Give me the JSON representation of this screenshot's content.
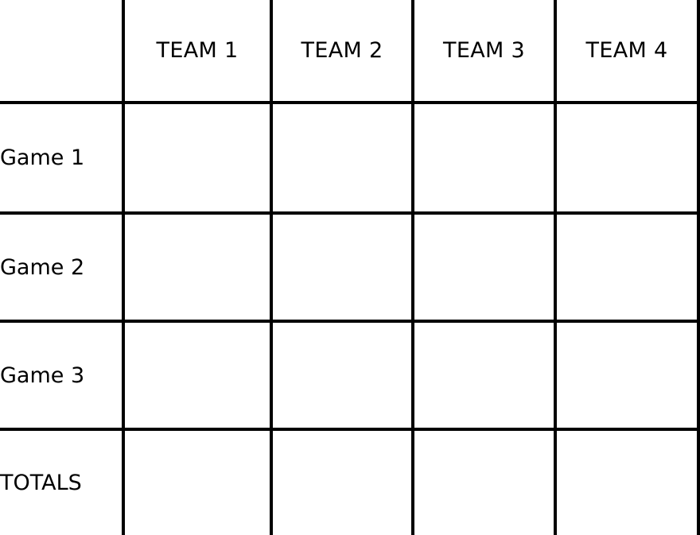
{
  "table": {
    "name": "team-game-score-grid",
    "corner_label": "",
    "column_headers": [
      {
        "id": "team-1",
        "label": "TEAM 1"
      },
      {
        "id": "team-2",
        "label": "TEAM 2"
      },
      {
        "id": "team-3",
        "label": "TEAM 3"
      },
      {
        "id": "team-4",
        "label": "TEAM 4"
      }
    ],
    "rows": [
      {
        "id": "game-1",
        "label": "Game 1",
        "cells": [
          "",
          "",
          "",
          ""
        ]
      },
      {
        "id": "game-2",
        "label": "Game 2",
        "cells": [
          "",
          "",
          "",
          ""
        ]
      },
      {
        "id": "game-3",
        "label": "Game 3",
        "cells": [
          "",
          "",
          "",
          ""
        ]
      },
      {
        "id": "totals",
        "label": "TOTALS",
        "cells": [
          "",
          "",
          "",
          ""
        ]
      }
    ],
    "colors": {
      "border": "#000000",
      "background": "#ffffff",
      "text": "#000000"
    }
  }
}
